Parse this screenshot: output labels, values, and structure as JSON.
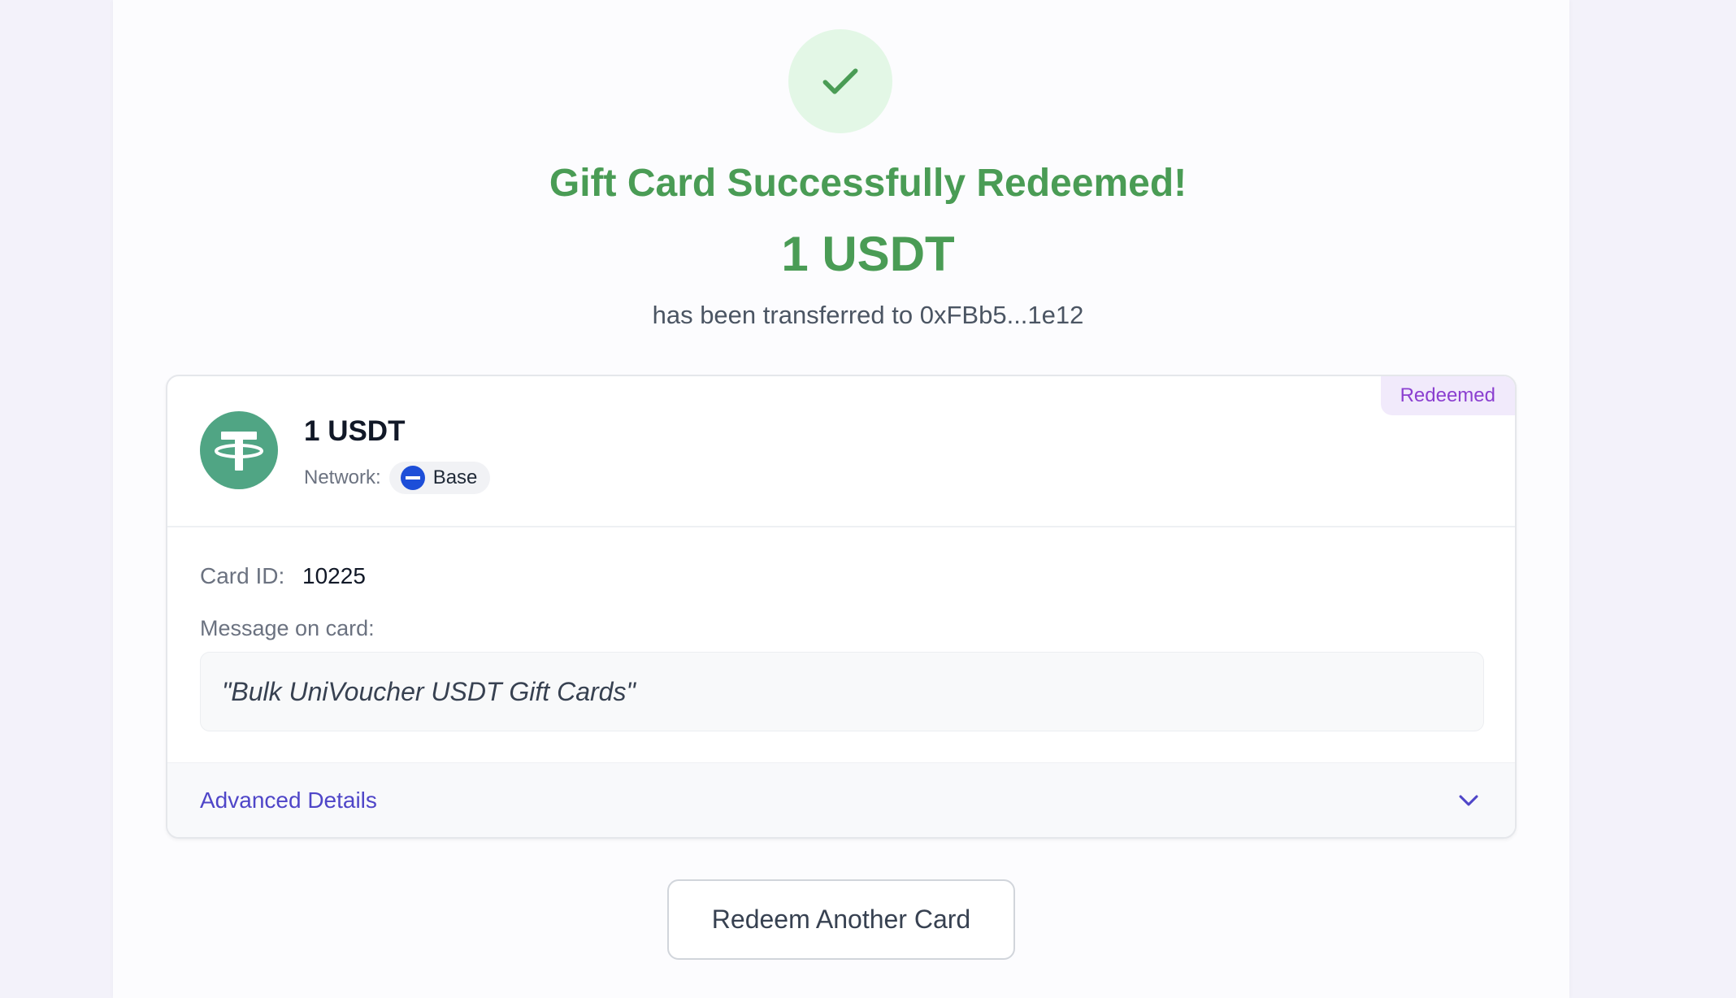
{
  "status": {
    "icon": "checkmark-icon",
    "title": "Gift Card Successfully Redeemed!",
    "amount": "1 USDT",
    "transfer_text": "has been transferred to 0xFBb5...1e12",
    "color": "#4a9c55"
  },
  "card": {
    "badge": "Redeemed",
    "token_icon": "tether-icon",
    "token_amount": "1 USDT",
    "network_label": "Network:",
    "network_name": "Base",
    "network_icon": "base-network-icon",
    "card_id_label": "Card ID:",
    "card_id_value": "10225",
    "message_label": "Message on card:",
    "message": "\"Bulk UniVoucher USDT Gift Cards\"",
    "advanced_label": "Advanced Details",
    "advanced_icon": "chevron-down-icon"
  },
  "actions": {
    "redeem_another": "Redeem Another Card"
  },
  "colors": {
    "success": "#4a9c55",
    "accent": "#4f46c8",
    "badge": "#8b3fd0",
    "tether": "#50a584",
    "base": "#1d4ed8"
  }
}
